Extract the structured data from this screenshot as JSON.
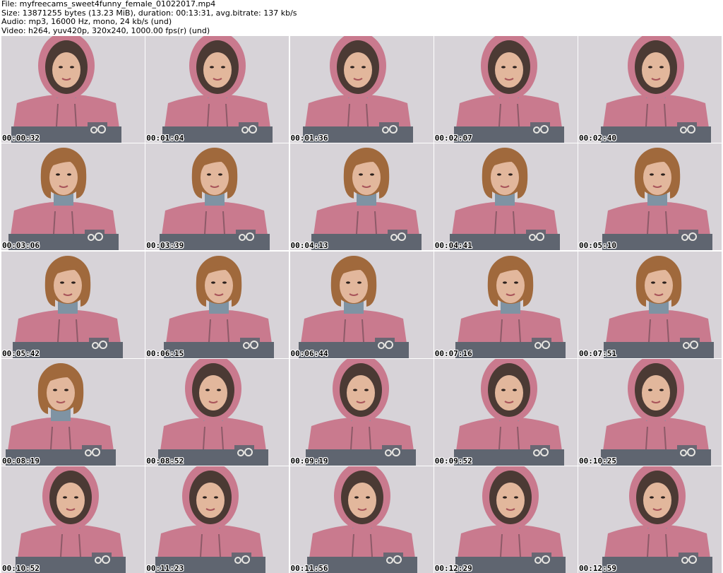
{
  "header": {
    "file_line": "File: myfreecams_sweet4funny_female_01022017.mp4",
    "size_line": "Size: 13871255 bytes (13.23 MiB), duration: 00:13:31, avg.bitrate: 137 kb/s",
    "audio_line": "Audio: mp3, 16000 Hz, mono, 24 kb/s (und)",
    "video_line": "Video: h264, yuv420p, 320x240, 1000.00 fps(r) (und)"
  },
  "colors": {
    "background": "#ffffff",
    "wall": "#d7d3d8",
    "hoodie_pink": "#c97a8e",
    "hoodie_gray": "#5f6570",
    "hair": "#a0693c",
    "skin": "#e2b79c"
  },
  "thumbnails": [
    {
      "time": "00:00:32"
    },
    {
      "time": "00:01:04"
    },
    {
      "time": "00:01:36"
    },
    {
      "time": "00:02:07"
    },
    {
      "time": "00:02:40"
    },
    {
      "time": "00:03:06"
    },
    {
      "time": "00:03:39"
    },
    {
      "time": "00:04:13"
    },
    {
      "time": "00:04:41"
    },
    {
      "time": "00:05:10"
    },
    {
      "time": "00:05:42"
    },
    {
      "time": "00:06:15"
    },
    {
      "time": "00:06:44"
    },
    {
      "time": "00:07:16"
    },
    {
      "time": "00:07:51"
    },
    {
      "time": "00:08:19"
    },
    {
      "time": "00:08:52"
    },
    {
      "time": "00:09:19"
    },
    {
      "time": "00:09:52"
    },
    {
      "time": "00:10:25"
    },
    {
      "time": "00:10:52"
    },
    {
      "time": "00:11:23"
    },
    {
      "time": "00:11:56"
    },
    {
      "time": "00:12:29"
    },
    {
      "time": "00:12:59"
    }
  ]
}
